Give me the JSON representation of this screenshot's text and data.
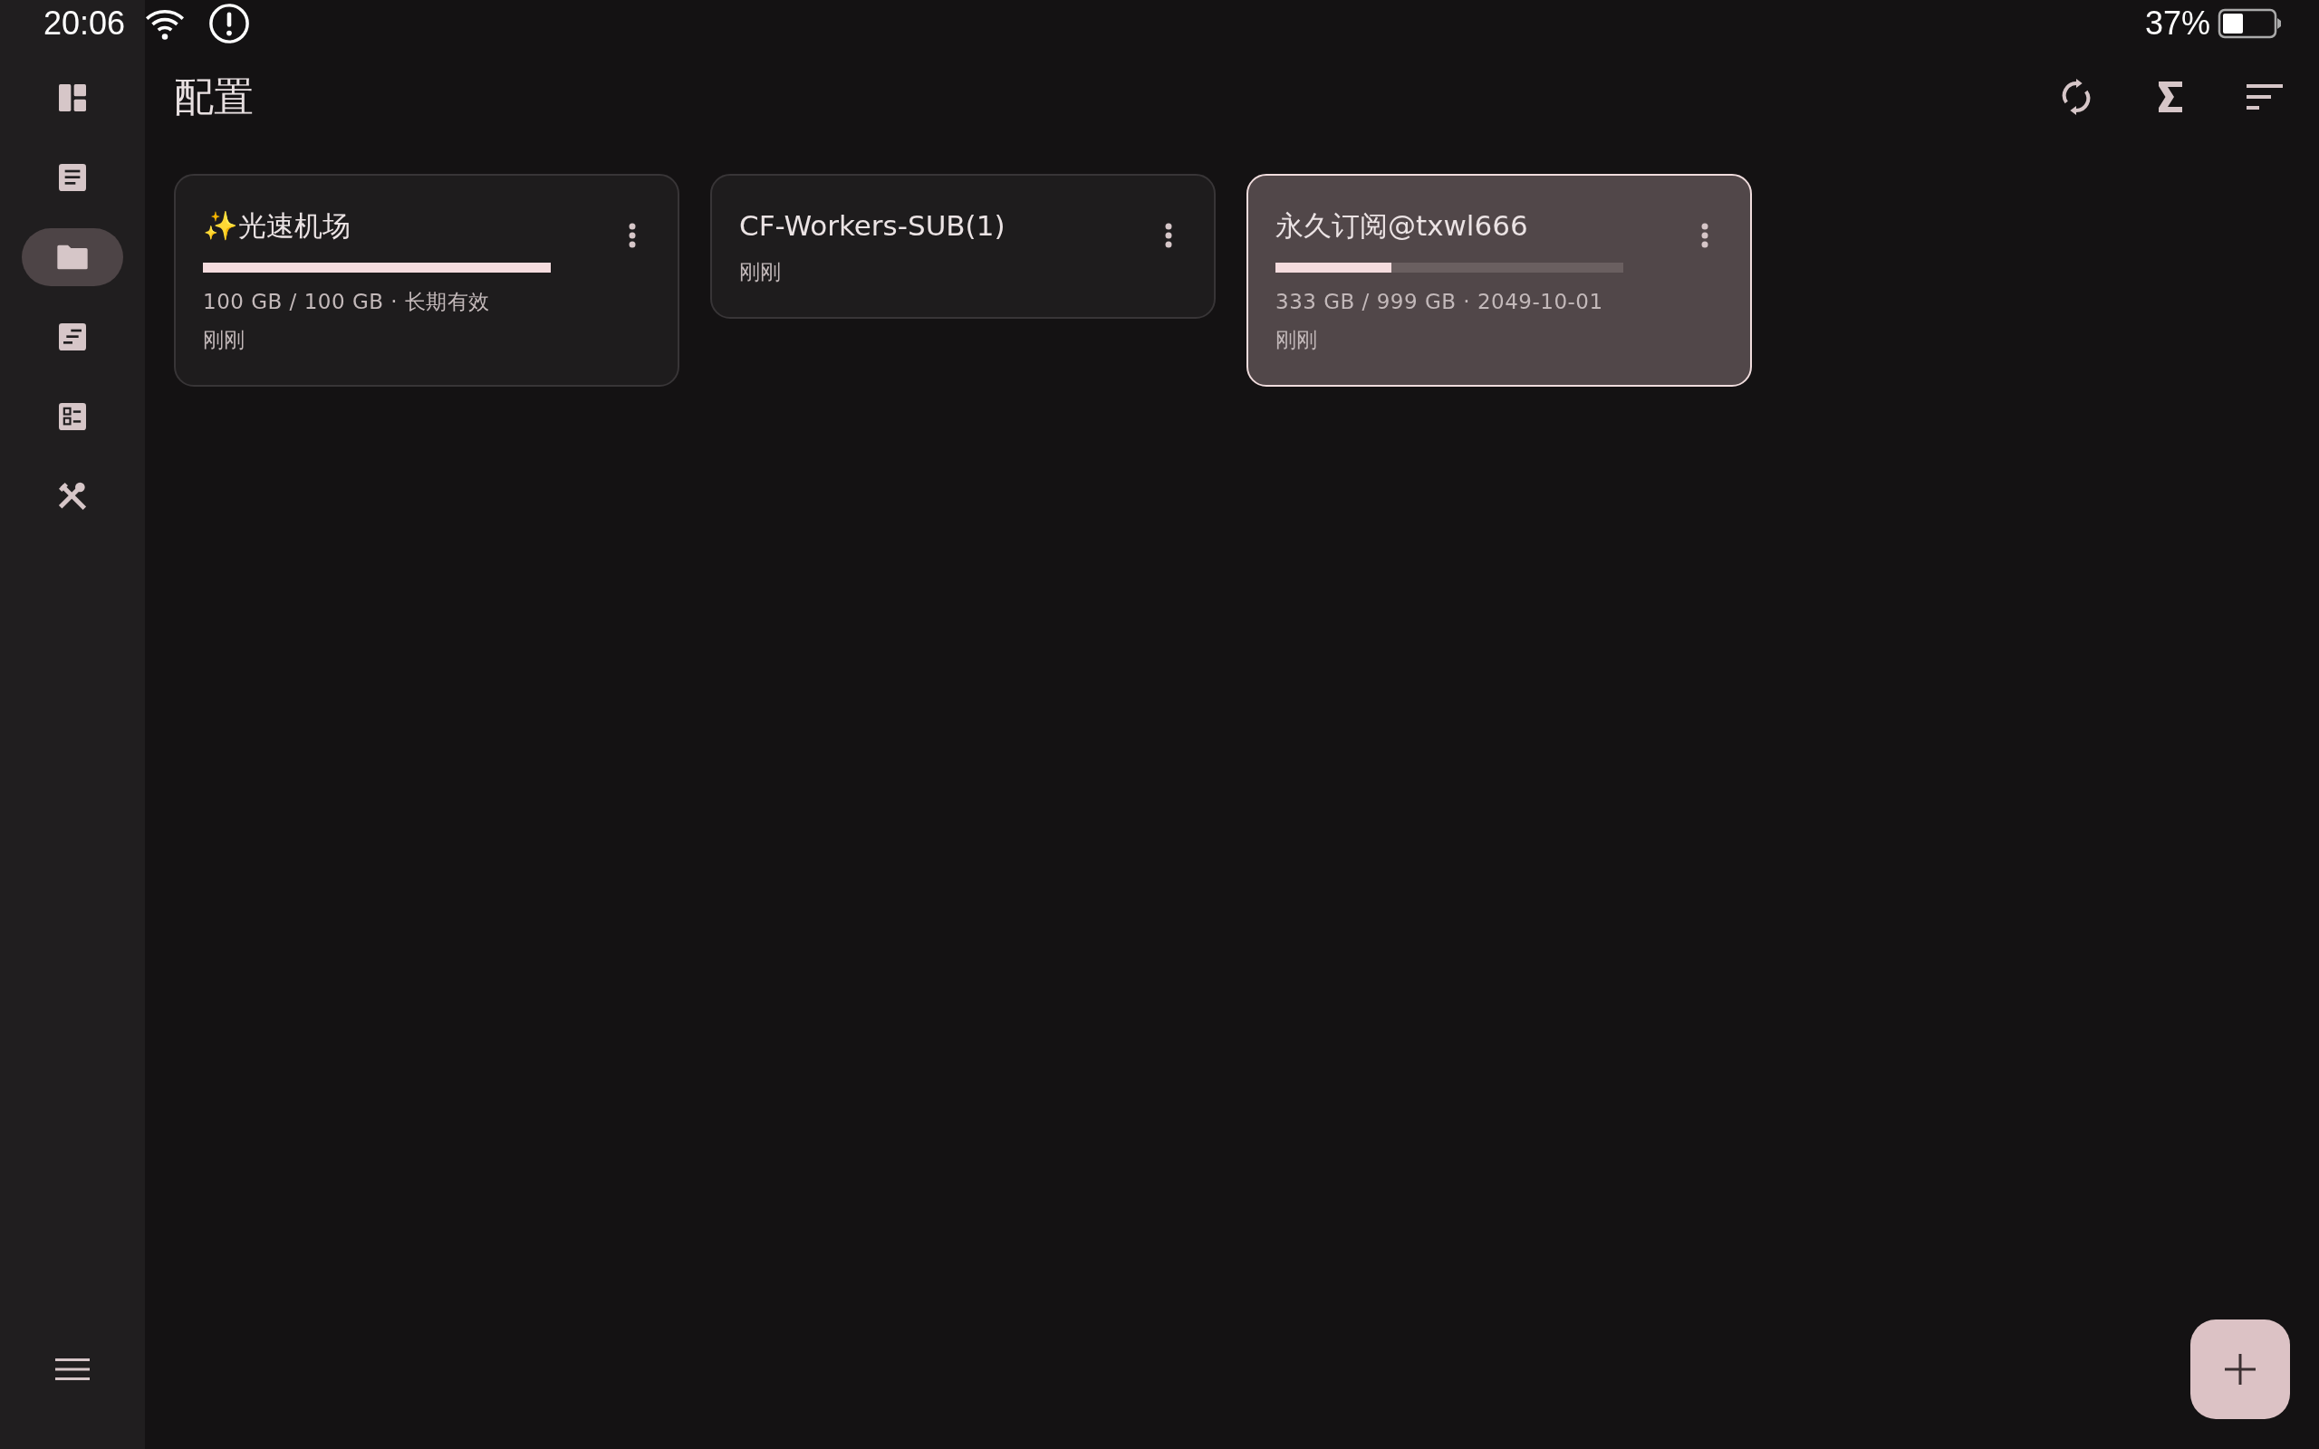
{
  "status_bar": {
    "time": "20:06",
    "battery": "37%"
  },
  "sidebar": {
    "items": [
      {
        "kind": "dashboard",
        "selected": false
      },
      {
        "kind": "document",
        "selected": false
      },
      {
        "kind": "folder",
        "selected": true
      },
      {
        "kind": "sorted-list",
        "selected": false
      },
      {
        "kind": "checklist",
        "selected": false
      },
      {
        "kind": "tools",
        "selected": false
      }
    ]
  },
  "header": {
    "title": "配置"
  },
  "cards": [
    {
      "name": "✨光速机场",
      "level": 1.0,
      "usage": "100 GB / 100 GB · 长期有效",
      "updated": "刚刚",
      "selected": false
    },
    {
      "name": "CF-Workers-SUB(1)",
      "updated": "刚刚",
      "selected": false
    },
    {
      "name": "永久订阅@txwl666",
      "level": 0.333,
      "usage": "333 GB / 999 GB · 2049-10-01",
      "updated": "刚刚",
      "selected": true
    }
  ]
}
